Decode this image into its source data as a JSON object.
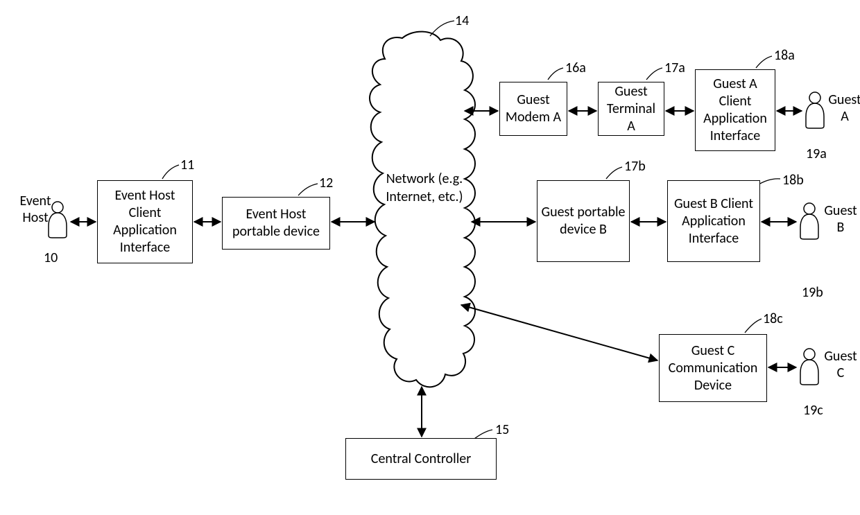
{
  "refs": {
    "event_host": "10",
    "event_host_interface": "11",
    "event_host_device": "12",
    "network": "14",
    "central_controller": "15",
    "guest_modem_a": "16a",
    "guest_terminal_a": "17a",
    "guest_portable_b": "17b",
    "guest_a_interface": "18a",
    "guest_b_interface": "18b",
    "guest_c_device": "18c",
    "guest_a_person": "19a",
    "guest_b_person": "19b",
    "guest_c_person": "19c"
  },
  "labels": {
    "event_host": "Event\nHost",
    "guest_a": "Guest\nA",
    "guest_b": "Guest\nB",
    "guest_c": "Guest\nC"
  },
  "boxes": {
    "event_host_interface": "Event Host Client Application Interface",
    "event_host_device": "Event Host portable device",
    "central_controller": "Central Controller",
    "guest_modem_a": "Guest Modem A",
    "guest_terminal_a": "Guest Terminal A",
    "guest_a_interface": "Guest A Client Application Interface",
    "guest_portable_b": "Guest portable device B",
    "guest_b_interface": "Guest B Client Application Interface",
    "guest_c_device": "Guest C Communication Device"
  },
  "network_text": "Network (e.g. Internet, etc.)"
}
